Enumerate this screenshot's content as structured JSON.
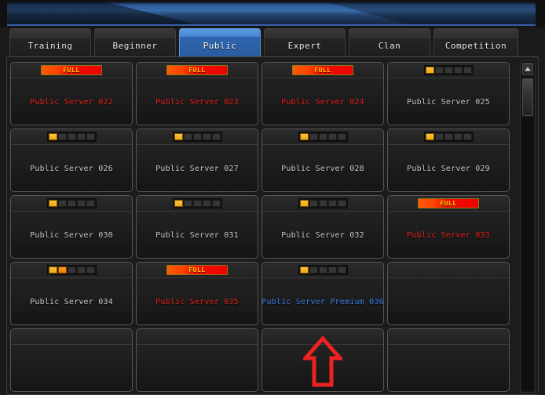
{
  "window": {
    "title_bar": "",
    "banner_accent": "#3a6dab"
  },
  "tabs": {
    "items": [
      {
        "label": "Training",
        "active": false
      },
      {
        "label": "Beginner",
        "active": false
      },
      {
        "label": "Public",
        "active": true
      },
      {
        "label": "Expert",
        "active": false
      },
      {
        "label": "Clan",
        "active": false
      },
      {
        "label": "Competition",
        "active": false
      }
    ],
    "active_label": "Public"
  },
  "colors": {
    "accent_blue": "#3a6dab",
    "tab_active": "#2f65ad",
    "full_red": "#e8221c",
    "premium_blue": "#3a7fe8",
    "meter_on": "#f0a814",
    "meter_off": "#353535",
    "annotation_red": "#ee2222"
  },
  "server_list": {
    "columns": 4,
    "rows": 5,
    "full_label": "FULL",
    "meter_segments": 5,
    "servers": [
      {
        "name": "Public Server 022",
        "status": "full",
        "filled": 5,
        "empty": false
      },
      {
        "name": "Public Server 023",
        "status": "full",
        "filled": 5,
        "empty": false
      },
      {
        "name": "Public Server 024",
        "status": "full",
        "filled": 5,
        "empty": false
      },
      {
        "name": "Public Server 025",
        "status": "normal",
        "filled": 1,
        "empty": false
      },
      {
        "name": "Public Server 026",
        "status": "normal",
        "filled": 1,
        "empty": false
      },
      {
        "name": "Public Server 027",
        "status": "normal",
        "filled": 1,
        "empty": false
      },
      {
        "name": "Public Server 028",
        "status": "normal",
        "filled": 1,
        "empty": false
      },
      {
        "name": "Public Server 029",
        "status": "normal",
        "filled": 1,
        "empty": false
      },
      {
        "name": "Public Server 030",
        "status": "normal",
        "filled": 1,
        "empty": false
      },
      {
        "name": "Public Server 031",
        "status": "normal",
        "filled": 1,
        "empty": false
      },
      {
        "name": "Public Server 032",
        "status": "normal",
        "filled": 1,
        "empty": false
      },
      {
        "name": "Public Server 033",
        "status": "full",
        "filled": 5,
        "empty": false
      },
      {
        "name": "Public Server 034",
        "status": "normal",
        "filled": 2,
        "empty": false
      },
      {
        "name": "Public Server 035",
        "status": "full",
        "filled": 5,
        "empty": false
      },
      {
        "name": "Public Server Premium 036",
        "status": "premium",
        "filled": 1,
        "empty": false
      },
      {
        "name": "",
        "status": "empty",
        "filled": 0,
        "empty": true
      },
      {
        "name": "",
        "status": "empty",
        "filled": 0,
        "empty": true
      },
      {
        "name": "",
        "status": "empty",
        "filled": 0,
        "empty": true
      },
      {
        "name": "",
        "status": "empty",
        "filled": 0,
        "empty": true
      },
      {
        "name": "",
        "status": "empty",
        "filled": 0,
        "empty": true
      }
    ]
  },
  "scrollbar": {
    "up_arrow_icon": "triangle-up-icon",
    "thumb_position_pct": 4,
    "thumb_size_pct": 12
  },
  "annotation": {
    "icon": "arrow-up-icon",
    "color": "#ee2222",
    "target": "Public Server Premium 036"
  }
}
